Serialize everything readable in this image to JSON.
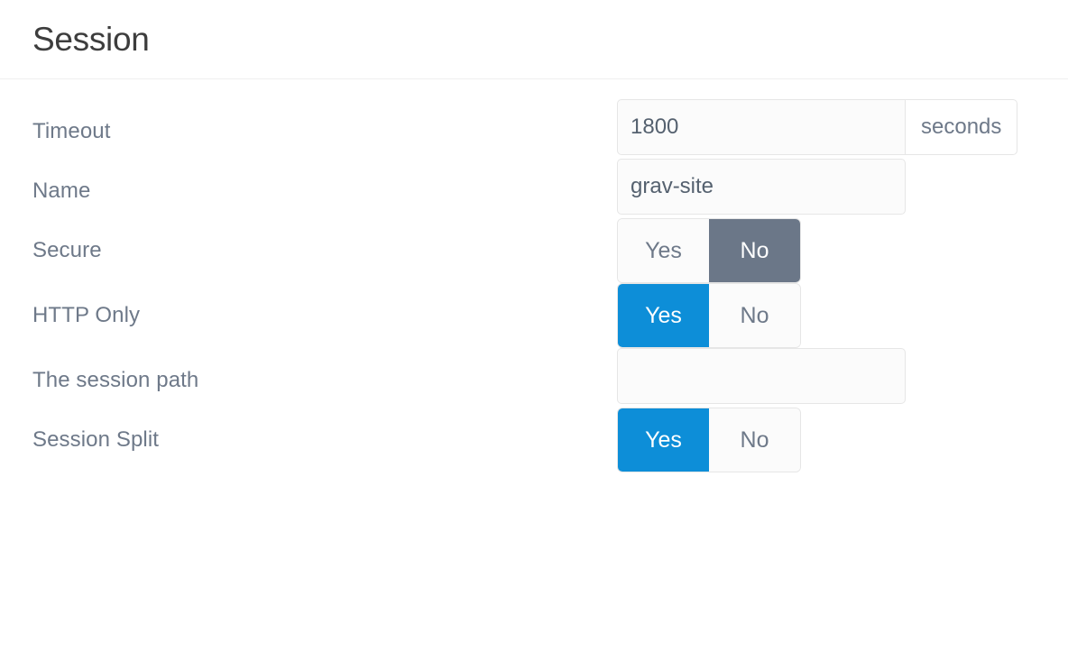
{
  "header": {
    "title": "Session"
  },
  "fields": [
    {
      "id": "timeout",
      "label": "Timeout",
      "type": "text",
      "value": "1800",
      "placeholder": "",
      "addon": "seconds"
    },
    {
      "id": "name",
      "label": "Name",
      "type": "text",
      "value": "grav-site",
      "placeholder": "",
      "addon": ""
    },
    {
      "id": "secure",
      "label": "Secure",
      "type": "toggle",
      "yes_label": "Yes",
      "no_label": "No",
      "selected": "No"
    },
    {
      "id": "http-only",
      "label": "HTTP Only",
      "type": "toggle",
      "yes_label": "Yes",
      "no_label": "No",
      "selected": "Yes"
    },
    {
      "id": "session-path",
      "label": "The session path",
      "type": "text",
      "value": "",
      "placeholder": "",
      "addon": ""
    },
    {
      "id": "session-split",
      "label": "Session Split",
      "type": "toggle",
      "yes_label": "Yes",
      "no_label": "No",
      "selected": "Yes"
    }
  ],
  "colors": {
    "accent_blue": "#0d8ed8",
    "selected_gray": "#6b7788",
    "label_text": "#6e7989",
    "title_text": "#3d3d3d",
    "input_bg": "#fbfbfb",
    "border": "#e6e6e6"
  }
}
